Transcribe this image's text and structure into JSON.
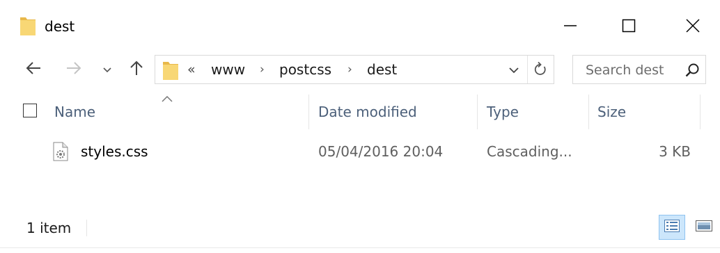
{
  "window": {
    "title": "dest",
    "folder_icon": "folder-icon",
    "controls": {
      "minimize_icon": "minimize-icon",
      "maximize_icon": "maximize-icon",
      "close_icon": "close-icon"
    }
  },
  "navigation": {
    "back_icon": "arrow-left-icon",
    "forward_icon": "arrow-right-icon",
    "recent_icon": "chevron-down-icon",
    "up_icon": "arrow-up-icon"
  },
  "address": {
    "overflow_label": "«",
    "breadcrumbs": [
      "www",
      "postcss",
      "dest"
    ],
    "separator": "›",
    "dropdown_icon": "chevron-down-icon",
    "refresh_icon": "refresh-icon"
  },
  "search": {
    "placeholder": "Search dest",
    "icon": "search-icon"
  },
  "columns": {
    "name": "Name",
    "date_modified": "Date modified",
    "type": "Type",
    "size": "Size",
    "sorted_by": "name"
  },
  "files": [
    {
      "name": "styles.css",
      "date_modified": "05/04/2016 20:04",
      "type": "Cascading...",
      "size": "3 KB",
      "icon": "css-file-icon"
    }
  ],
  "status": {
    "item_count": "1 item",
    "active_view": "details"
  },
  "colors": {
    "folder_yellow": "#f8d775",
    "folder_dark": "#e8b84a",
    "header_text": "#4c607a",
    "selected_view_bg": "#cce6fb",
    "selected_view_border": "#8fc3f0"
  }
}
